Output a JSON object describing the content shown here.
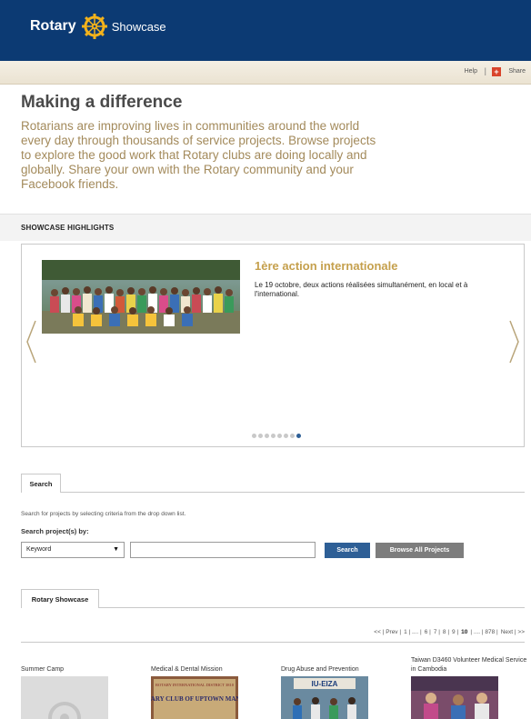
{
  "header": {
    "brand_left": "Rotary",
    "brand_right": "Showcase"
  },
  "utility": {
    "help": "Help",
    "separator": "|",
    "share": "Share",
    "share_icon_glyph": "+"
  },
  "intro": {
    "title": "Making a difference",
    "text": "Rotarians are improving lives in communities around the world every day through thousands of service projects. Browse projects to explore the good work that Rotary clubs are doing locally and globally. Share your own with the Rotary community and your Facebook friends."
  },
  "highlights": {
    "section_title": "SHOWCASE HIGHLIGHTS",
    "slide_title": "1ère action internationale",
    "slide_text": "Le 19 octobre, deux actions réalisées simultanément, en local et à l'international.",
    "slide_count": 8,
    "active_slide_index": 7
  },
  "search": {
    "tab_label": "Search",
    "help_text": "Search for projects by selecting criteria from the drop down list.",
    "by_label": "Search project(s) by:",
    "select_value": "Keyword",
    "input_value": "",
    "search_button": "Search",
    "browse_button": "Browse All Projects"
  },
  "showcase": {
    "tab_label": "Rotary Showcase",
    "pager": [
      "<< | Prev |",
      "1 | .... |",
      "6 |",
      "7 |",
      "8 |",
      "9 |",
      "10",
      "| .... | 878 |",
      "Next | >>"
    ],
    "pager_current_index": 6,
    "cards": [
      {
        "title": "Summer Camp"
      },
      {
        "title": "Medical & Dental Mission"
      },
      {
        "title": "Drug Abuse and Prevention"
      },
      {
        "title": "Taiwan D3460 Volunteer Medical Service in Cambodia"
      }
    ],
    "thumb_text": {
      "banner_line1": "ROTARY INTERNATIONAL DISTRICT 3810",
      "banner_line2": "ROTARY CLUB OF UPTOWN MANILA",
      "banner_sign": "IU-EIZA"
    }
  },
  "colors": {
    "header_bg": "#0c3a73",
    "accent_gold": "#c5a04d",
    "intro_text": "#a38a5b",
    "button_blue": "#2e5f96",
    "button_grey": "#7d7d7d"
  },
  "icons": {
    "logo": "rotary-wheel-icon",
    "share": "share-plus-icon",
    "prev": "chevron-left-icon",
    "next": "chevron-right-icon",
    "dropdown": "caret-down-icon"
  }
}
